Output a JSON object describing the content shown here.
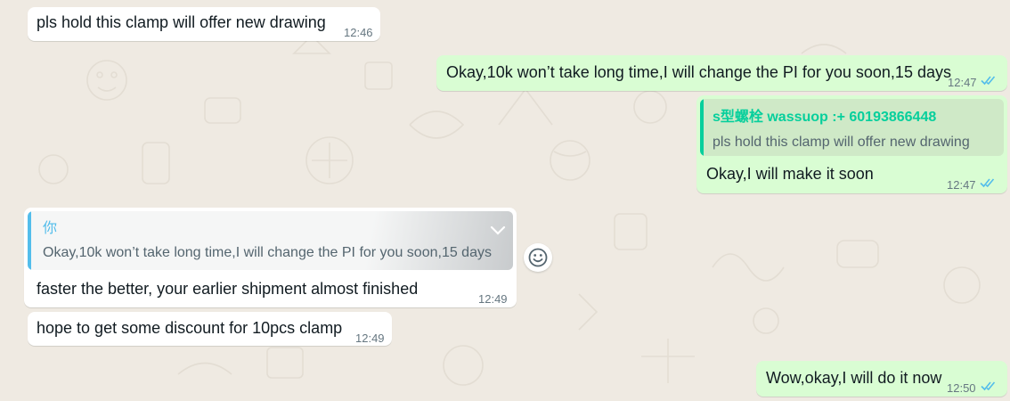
{
  "colors": {
    "background": "#efeae2",
    "incoming_bubble": "#ffffff",
    "outgoing_bubble": "#d9fdd3",
    "read_ticks": "#53bdeb",
    "quote_own_author": "#53bdeb",
    "quote_contact_author": "#06cf9c"
  },
  "messages": [
    {
      "direction": "incoming",
      "text": "pls  hold this  clamp will offer new drawing",
      "time": "12:46"
    },
    {
      "direction": "outgoing",
      "text": "Okay,10k won’t take long time,I will change the PI for you soon,15 days",
      "time": "12:47",
      "status": "read"
    },
    {
      "direction": "outgoing",
      "quote": {
        "author": "s型螺栓 wassuop :+ 60193866448",
        "text": "pls  hold this  clamp will offer new drawing"
      },
      "text": "Okay,I will make it soon",
      "time": "12:47",
      "status": "read"
    },
    {
      "direction": "incoming",
      "quote": {
        "author": "你",
        "text": "Okay,10k won’t take long time,I will change the PI for you soon,15 days"
      },
      "text": "faster the better, your earlier shipment almost finished",
      "time": "12:49"
    },
    {
      "direction": "incoming",
      "text": "hope to get some  discount for 10pcs clamp",
      "time": "12:49"
    },
    {
      "direction": "outgoing",
      "text": "Wow,okay,I will do it now",
      "time": "12:50",
      "status": "read"
    }
  ],
  "icons": {
    "reaction": "emoji-smiley-icon",
    "menu": "chevron-down-icon",
    "read_receipt": "double-check-icon"
  }
}
